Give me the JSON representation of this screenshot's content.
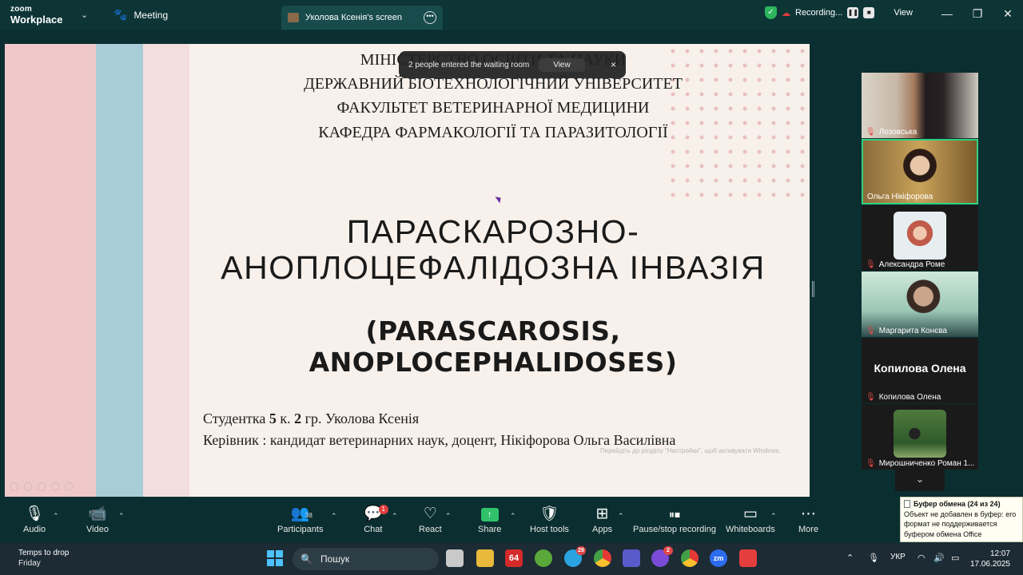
{
  "titlebar": {
    "logo_line1": "zoom",
    "logo_line2": "Workplace",
    "meeting_label": "Meeting",
    "share_tab_label": "Уколова Ксенія's screen",
    "recording_label": "Recording...",
    "view_label": "View"
  },
  "slide": {
    "header_lines": [
      "МІНІСТЕРСТВО ОСВІТИ ТА НАУКИ",
      "ДЕРЖАВНИЙ БІОТЕХНОЛОГІЧНИЙ УНІВЕРСИТЕТ",
      "ФАКУЛЬТЕТ ВЕТЕРИНАРНОЇ МЕДИЦИНИ",
      "КАФЕДРА ФАРМАКОЛОГІЇ ТА ПАРАЗИТОЛОГІЇ"
    ],
    "title_line1": "ПАРАСКАРОЗНО-",
    "title_line2": "АНОПЛОЦЕФАЛІДОЗНА ІНВАЗІЯ",
    "latin_title": "(PARASCAROSIS, ANOPLOCEPHALIDOSES)",
    "student_prefix": "Студентка ",
    "student_course": "5",
    "student_mid": " к. ",
    "student_group": "2",
    "student_suffix": " гр. Уколова Ксенія",
    "supervisor": "Керівник : кандидат ветеринарних наук, доцент, Нікіфорова Ольга Василівна",
    "activation_watermark": "Перейдіть до розділу \"Настройки\", щоб активувати Windows."
  },
  "toast": {
    "message": "2 people entered the waiting room",
    "view_label": "View",
    "close_label": "×"
  },
  "participants": [
    {
      "name": "Лозовська",
      "type": "video",
      "active": false
    },
    {
      "name": "Ольга Нікіфорова",
      "type": "video",
      "active": true
    },
    {
      "name": "Александра Роме",
      "type": "avatar",
      "active": false
    },
    {
      "name": "Маргарита Конєва",
      "type": "video",
      "active": false
    },
    {
      "name": "Копилова Олена",
      "type": "text",
      "display": "Копилова Олена",
      "active": false
    },
    {
      "name": "Мирошниченко Роман 1...",
      "type": "avatar",
      "active": false
    }
  ],
  "toolbar": {
    "audio": "Audio",
    "video": "Video",
    "participants": "Participants",
    "participants_count": "38",
    "chat": "Chat",
    "chat_badge": "1",
    "react": "React",
    "share": "Share",
    "host_tools": "Host tools",
    "apps": "Apps",
    "pause_stop": "Pause/stop recording",
    "whiteboards": "Whiteboards",
    "more": "More"
  },
  "clipboard": {
    "title": "Буфер обмена (24 из 24)",
    "message": "Объект не добавлен в буфер: его формат не поддерживается буфером обмена Office"
  },
  "taskbar": {
    "weather_line1": "Temps to drop",
    "weather_line2": "Friday",
    "search_placeholder": "Пошук",
    "app_64": "64",
    "telegram_badge": "29",
    "viber_badge": "2",
    "lang": "УКР",
    "time": "12:07",
    "date": "17.06.2025"
  },
  "colors": {
    "zoom_bg": "#0b2f30",
    "slide_bg": "#f7f0eb",
    "active_speaker": "#35d07f",
    "share_green": "#2fc26a",
    "recording_red": "#e43c3c"
  }
}
